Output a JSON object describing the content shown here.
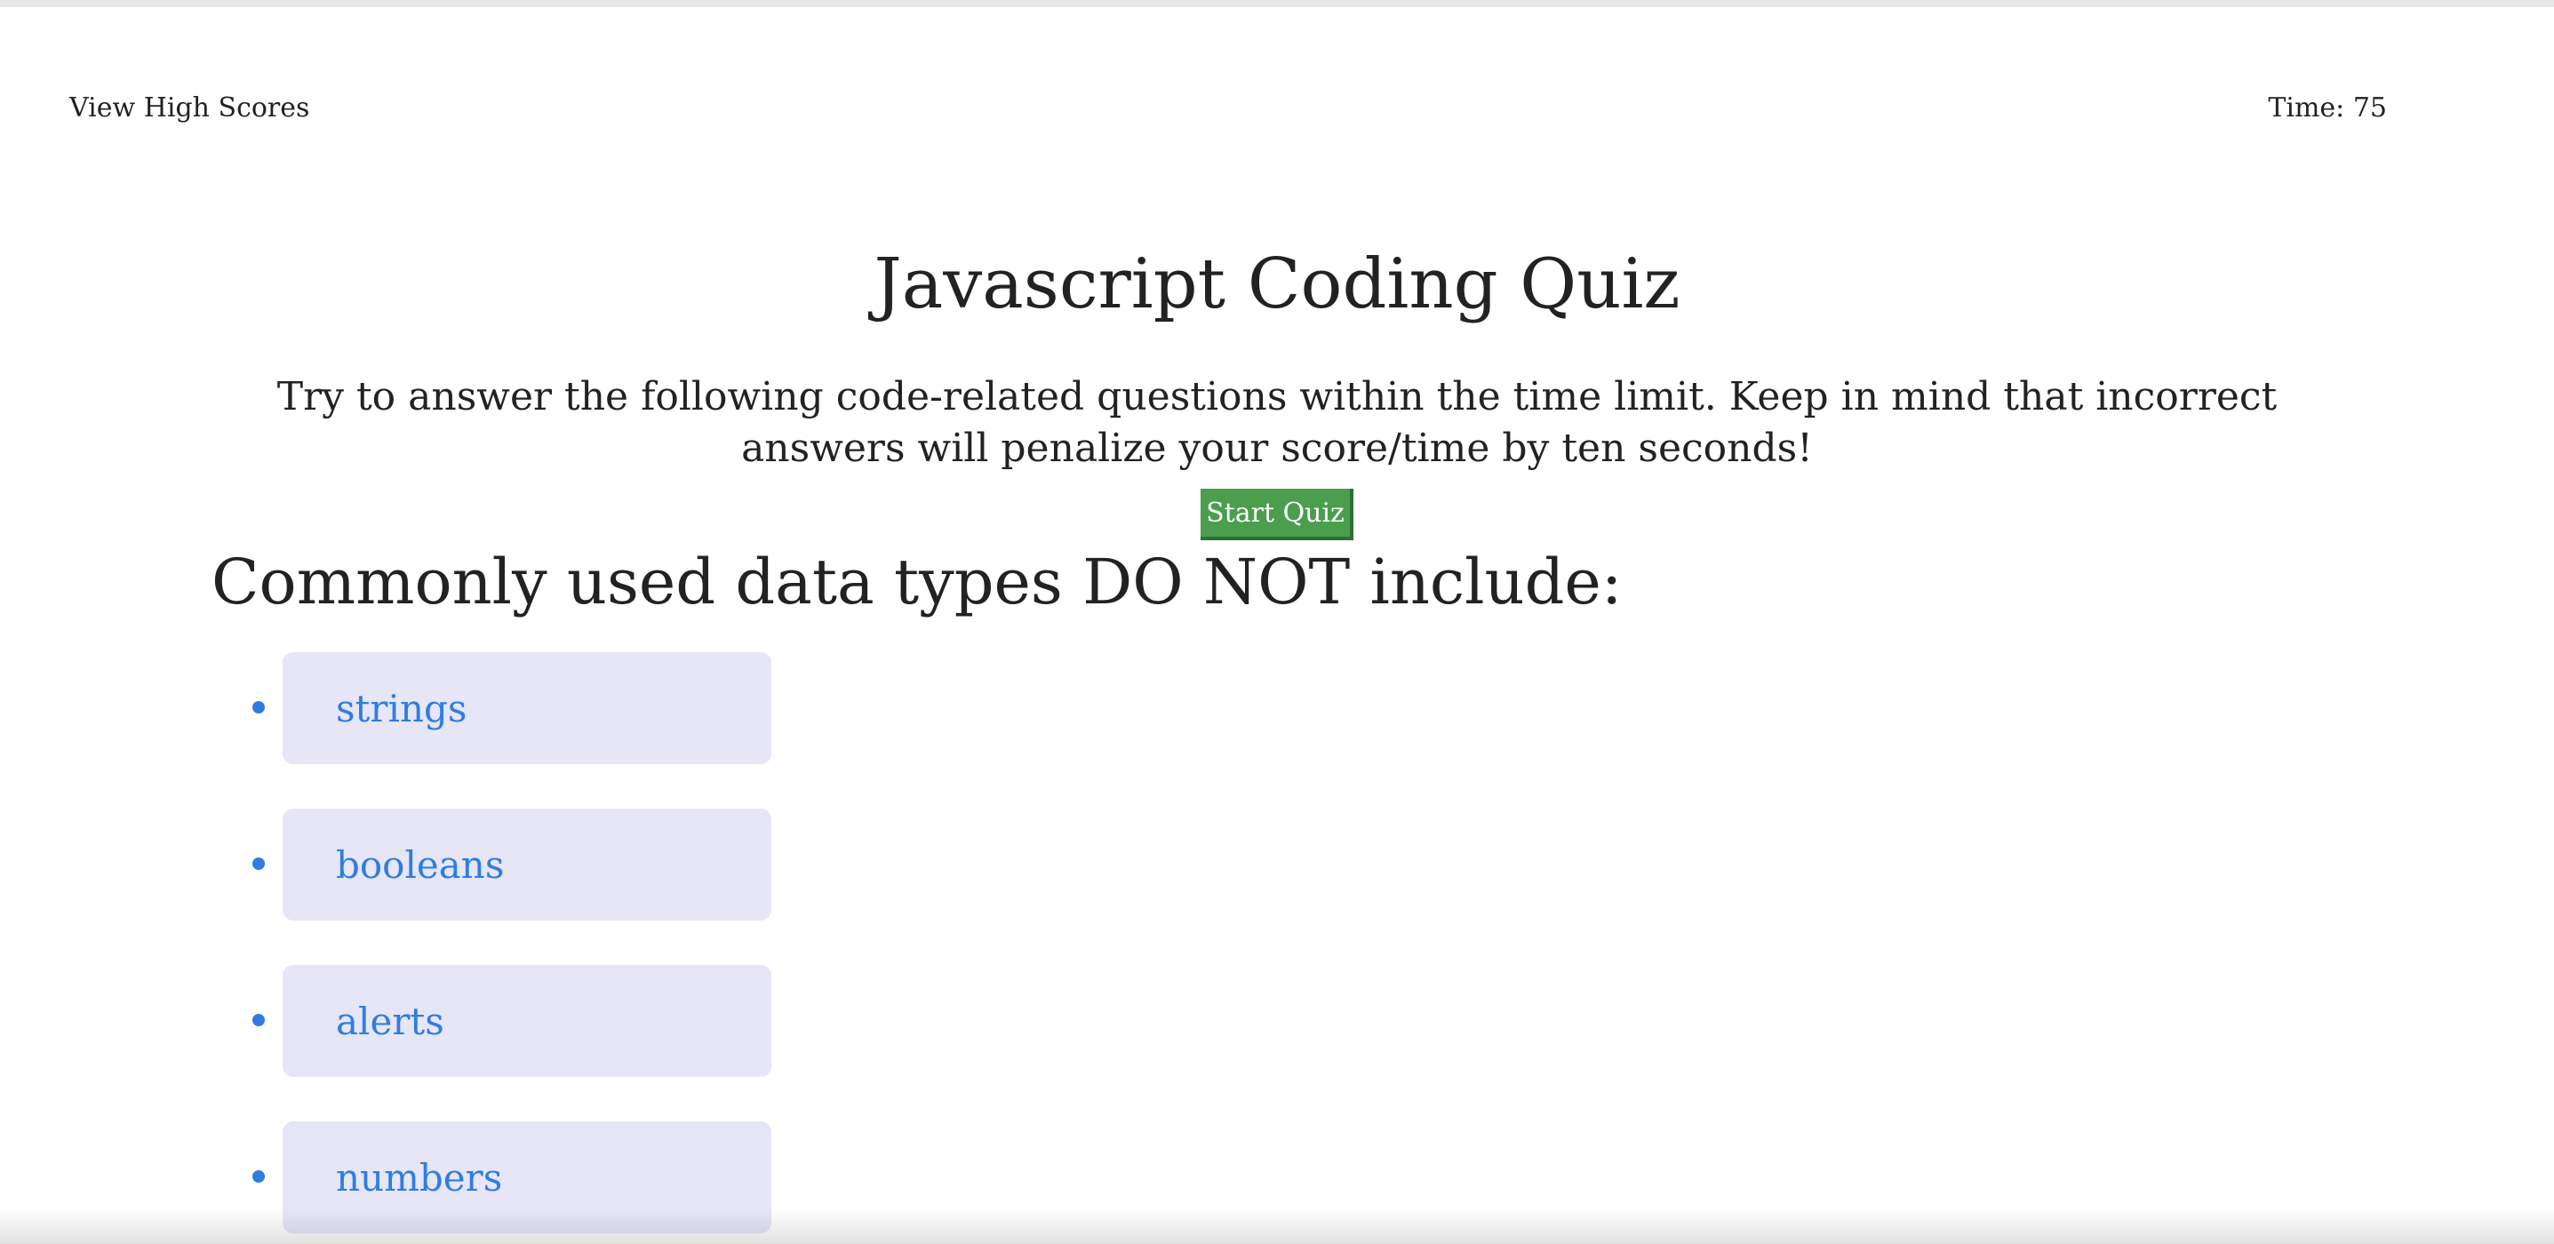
{
  "header": {
    "high_scores_label": "View High Scores",
    "timer_label": "Time: 75"
  },
  "intro": {
    "title": "Javascript Coding Quiz",
    "instructions": "Try to answer the following code-related questions within the time limit. Keep in mind that incorrect answers will penalize your score/time by ten seconds!",
    "start_label": "Start Quiz"
  },
  "quiz": {
    "question": "Commonly used data types DO NOT include:",
    "answers": [
      {
        "label": "strings"
      },
      {
        "label": "booleans"
      },
      {
        "label": "alerts"
      },
      {
        "label": "numbers"
      }
    ]
  },
  "colors": {
    "start_button": "#4a9e4c",
    "answer_background": "#e6e6f7",
    "answer_text": "#2f7de1"
  }
}
